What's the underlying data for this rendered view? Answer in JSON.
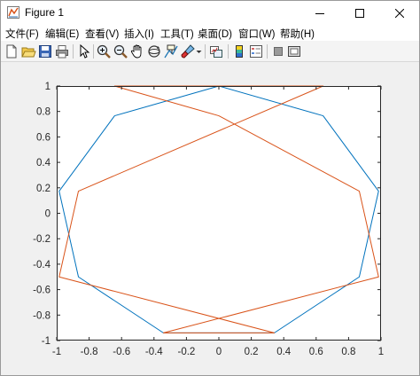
{
  "window": {
    "title": "Figure 1",
    "icon": "matlab-figure-icon"
  },
  "menu": [
    {
      "label": "文件(F)"
    },
    {
      "label": "编辑(E)"
    },
    {
      "label": "查看(V)"
    },
    {
      "label": "插入(I)"
    },
    {
      "label": "工具(T)"
    },
    {
      "label": "桌面(D)"
    },
    {
      "label": "窗口(W)"
    },
    {
      "label": "帮助(H)"
    }
  ],
  "toolbar": [
    "new-figure-icon",
    "open-file-icon",
    "save-icon",
    "print-icon",
    "edit-plot-arrow-icon",
    "zoom-in-icon",
    "zoom-out-icon",
    "pan-hand-icon",
    "rotate-3d-icon",
    "data-cursor-icon",
    "brush-icon",
    "link-plot-icon",
    "colorbar-icon",
    "legend-icon",
    "hide-plot-tools-icon",
    "show-plot-tools-icon"
  ],
  "chart_data": {
    "type": "line",
    "title": "",
    "xlabel": "",
    "ylabel": "",
    "xlim": [
      -1,
      1
    ],
    "ylim": [
      -1,
      1
    ],
    "xticks": [
      -1,
      -0.8,
      -0.6,
      -0.4,
      -0.2,
      0,
      0.2,
      0.4,
      0.6,
      0.8,
      1
    ],
    "xtick_labels": [
      "-1",
      "-0.8",
      "-0.6",
      "-0.4",
      "-0.2",
      "0",
      "0.2",
      "0.4",
      "0.6",
      "0.8",
      "1"
    ],
    "yticks": [
      -1,
      -0.8,
      -0.6,
      -0.4,
      -0.2,
      0,
      0.2,
      0.4,
      0.6,
      0.8,
      1
    ],
    "ytick_labels": [
      "-1",
      "-0.8",
      "-0.6",
      "-0.4",
      "-0.2",
      "0",
      "0.2",
      "0.4",
      "0.6",
      "0.8",
      "1"
    ],
    "grid": false,
    "series": [
      {
        "color": "#0072BD",
        "x": [
          0,
          0.643,
          0.985,
          0.866,
          0.342,
          -0.342,
          -0.866,
          -0.985,
          -0.643,
          0
        ],
        "y": [
          1,
          0.766,
          0.174,
          -0.5,
          -0.94,
          -0.94,
          -0.5,
          0.174,
          0.766,
          1
        ]
      },
      {
        "color": "#D95319",
        "x": [
          0,
          0.866,
          0.985,
          -0.342,
          0.342,
          -0.985,
          -0.866,
          0.643,
          -0.643,
          0
        ],
        "y": [
          0.766,
          0.174,
          -0.5,
          -0.94,
          -0.94,
          -0.5,
          0.174,
          1,
          1,
          0.766
        ]
      }
    ]
  }
}
